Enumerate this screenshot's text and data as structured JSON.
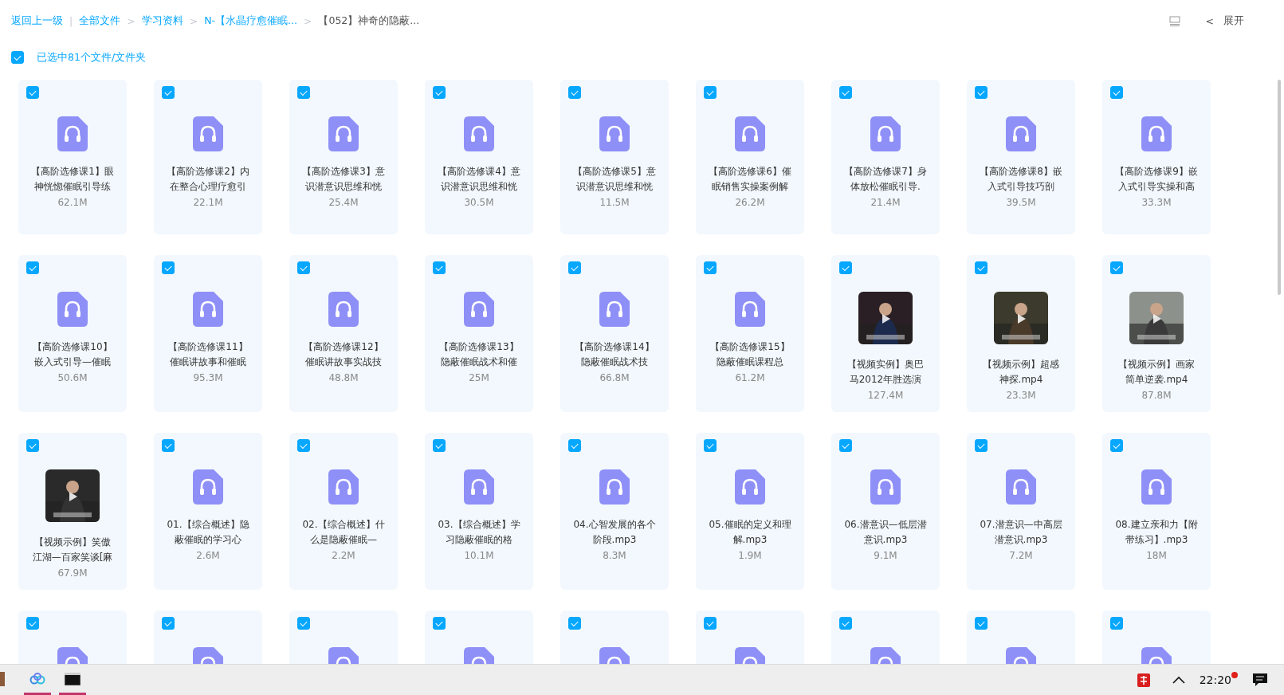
{
  "breadcrumb": {
    "back": "返回上一级",
    "separator": "|",
    "items": [
      {
        "label": "全部文件",
        "current": false
      },
      {
        "label": "学习资料",
        "current": false
      },
      {
        "label": "N-【水晶疗愈催眠...",
        "current": false
      },
      {
        "label": "【052】神奇的隐蔽...",
        "current": true
      }
    ],
    "arrow": ">"
  },
  "toolbar": {
    "collapse_arrow": "<",
    "expand": "展开"
  },
  "select_all": {
    "checked": true,
    "label": "已选中81个文件/文件夹"
  },
  "files": [
    {
      "kind": "audio",
      "selected": true,
      "lines": [
        "【高阶选修课1】眼",
        "神恍惚催眠引导练"
      ],
      "size": "62.1M"
    },
    {
      "kind": "audio",
      "selected": true,
      "lines": [
        "【高阶选修课2】内",
        "在整合心理疗愈引"
      ],
      "size": "22.1M"
    },
    {
      "kind": "audio",
      "selected": true,
      "lines": [
        "【高阶选修课3】意",
        "识潜意识思维和恍"
      ],
      "size": "25.4M"
    },
    {
      "kind": "audio",
      "selected": true,
      "lines": [
        "【高阶选修课4】意",
        "识潜意识思维和恍"
      ],
      "size": "30.5M"
    },
    {
      "kind": "audio",
      "selected": true,
      "lines": [
        "【高阶选修课5】意",
        "识潜意识思维和恍"
      ],
      "size": "11.5M"
    },
    {
      "kind": "audio",
      "selected": true,
      "lines": [
        "【高阶选修课6】催",
        "眠销售实操案例解"
      ],
      "size": "26.2M"
    },
    {
      "kind": "audio",
      "selected": true,
      "lines": [
        "【高阶选修课7】身",
        "体放松催眠引导."
      ],
      "size": "21.4M"
    },
    {
      "kind": "audio",
      "selected": true,
      "lines": [
        "【高阶选修课8】嵌",
        "入式引导技巧剖"
      ],
      "size": "39.5M"
    },
    {
      "kind": "audio",
      "selected": true,
      "lines": [
        "【高阶选修课9】嵌",
        "入式引导实操和高"
      ],
      "size": "33.3M"
    },
    {
      "kind": "audio",
      "selected": true,
      "lines": [
        "【高阶选修课10】",
        "嵌入式引导—催眠"
      ],
      "size": "50.6M"
    },
    {
      "kind": "audio",
      "selected": true,
      "lines": [
        "【高阶选修课11】",
        "催眠讲故事和催眠"
      ],
      "size": "95.3M"
    },
    {
      "kind": "audio",
      "selected": true,
      "lines": [
        "【高阶选修课12】",
        "催眠讲故事实战技"
      ],
      "size": "48.8M"
    },
    {
      "kind": "audio",
      "selected": true,
      "lines": [
        "【高阶选修课13】",
        "隐蔽催眠战术和催"
      ],
      "size": "25M"
    },
    {
      "kind": "audio",
      "selected": true,
      "lines": [
        "【高阶选修课14】",
        "隐蔽催眠战术技"
      ],
      "size": "66.8M"
    },
    {
      "kind": "audio",
      "selected": true,
      "lines": [
        "【高阶选修课15】",
        "隐蔽催眠课程总"
      ],
      "size": "61.2M"
    },
    {
      "kind": "video",
      "selected": true,
      "lines": [
        "【视频实例】奥巴",
        "马2012年胜选演"
      ],
      "size": "127.4M"
    },
    {
      "kind": "video",
      "selected": true,
      "lines": [
        "【视频示例】超感",
        "神探.mp4"
      ],
      "size": "23.3M"
    },
    {
      "kind": "video",
      "selected": true,
      "lines": [
        "【视频示例】画家",
        "简单逆袭.mp4"
      ],
      "size": "87.8M"
    },
    {
      "kind": "video",
      "selected": true,
      "lines": [
        "【视频示例】笑傲",
        "江湖—百家笑谈[麻"
      ],
      "size": "67.9M"
    },
    {
      "kind": "audio",
      "selected": true,
      "lines": [
        "01.【综合概述】隐",
        "蔽催眠的学习心"
      ],
      "size": "2.6M"
    },
    {
      "kind": "audio",
      "selected": true,
      "lines": [
        "02.【综合概述】什",
        "么是隐蔽催眠—"
      ],
      "size": "2.2M"
    },
    {
      "kind": "audio",
      "selected": true,
      "lines": [
        "03.【综合概述】学",
        "习隐蔽催眠的格"
      ],
      "size": "10.1M"
    },
    {
      "kind": "audio",
      "selected": true,
      "lines": [
        "04.心智发展的各个",
        "阶段.mp3"
      ],
      "size": "8.3M"
    },
    {
      "kind": "audio",
      "selected": true,
      "lines": [
        "05.催眠的定义和理",
        "解.mp3"
      ],
      "size": "1.9M"
    },
    {
      "kind": "audio",
      "selected": true,
      "lines": [
        "06.潜意识—低层潜",
        "意识.mp3"
      ],
      "size": "9.1M"
    },
    {
      "kind": "audio",
      "selected": true,
      "lines": [
        "07.潜意识—中高层",
        "潜意识.mp3"
      ],
      "size": "7.2M"
    },
    {
      "kind": "audio",
      "selected": true,
      "lines": [
        "08.建立亲和力【附",
        "带练习】.mp3"
      ],
      "size": "18M"
    },
    {
      "kind": "audio",
      "selected": true
    },
    {
      "kind": "audio",
      "selected": true
    },
    {
      "kind": "audio",
      "selected": true
    },
    {
      "kind": "audio",
      "selected": true
    },
    {
      "kind": "audio",
      "selected": true
    },
    {
      "kind": "audio",
      "selected": true
    },
    {
      "kind": "audio",
      "selected": true
    },
    {
      "kind": "audio",
      "selected": true
    },
    {
      "kind": "audio",
      "selected": true
    }
  ],
  "taskbar": {
    "clock": "22:20",
    "notification": true
  }
}
